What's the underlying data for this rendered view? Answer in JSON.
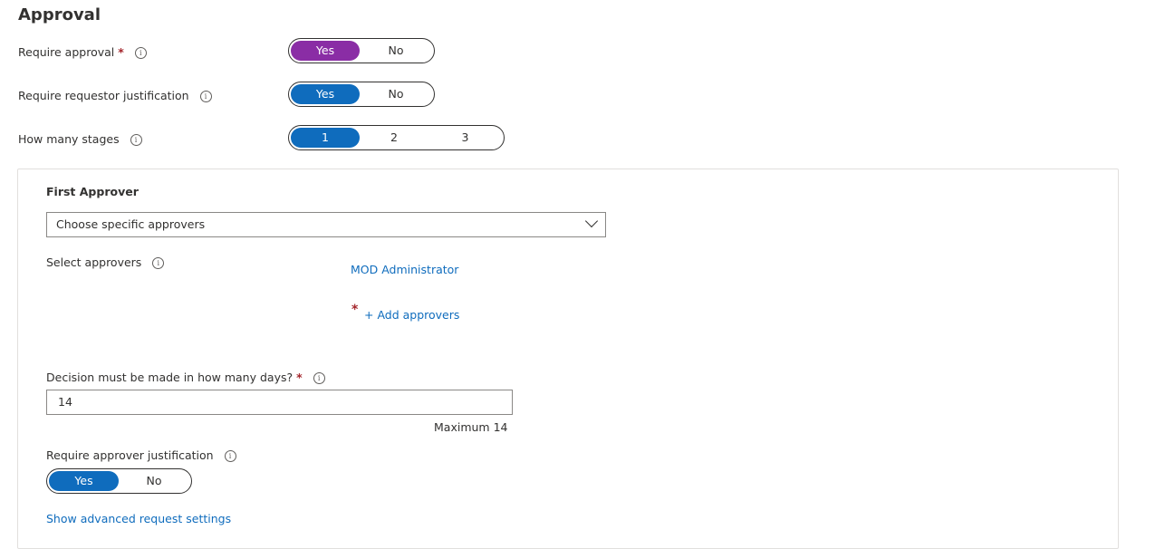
{
  "approval": {
    "title": "Approval",
    "require_approval": {
      "label": "Require approval",
      "required_mark": "*",
      "info": "i",
      "options": [
        "Yes",
        "No"
      ],
      "selected": "Yes",
      "accent": "#8a2da5"
    },
    "require_justification": {
      "label": "Require requestor justification",
      "info": "i",
      "options": [
        "Yes",
        "No"
      ],
      "selected": "Yes",
      "accent": "#0f6cbd"
    },
    "stages": {
      "label": "How many stages",
      "info": "i",
      "options": [
        "1",
        "2",
        "3"
      ],
      "selected": "1",
      "accent": "#0f6cbd"
    }
  },
  "first_approver": {
    "title": "First Approver",
    "dropdown_value": "Choose specific approvers",
    "select_label": "Select approvers",
    "info": "i",
    "approvers": [
      "MOD Administrator"
    ],
    "add_required_mark": "*",
    "add_link": "+ Add approvers",
    "decision_label": "Decision must be made in how many days?",
    "decision_required_mark": "*",
    "decision_value": "14",
    "decision_hint": "Maximum 14",
    "approver_justification": {
      "label": "Require approver justification",
      "options": [
        "Yes",
        "No"
      ],
      "selected": "Yes"
    },
    "advanced_link": "Show advanced request settings"
  }
}
